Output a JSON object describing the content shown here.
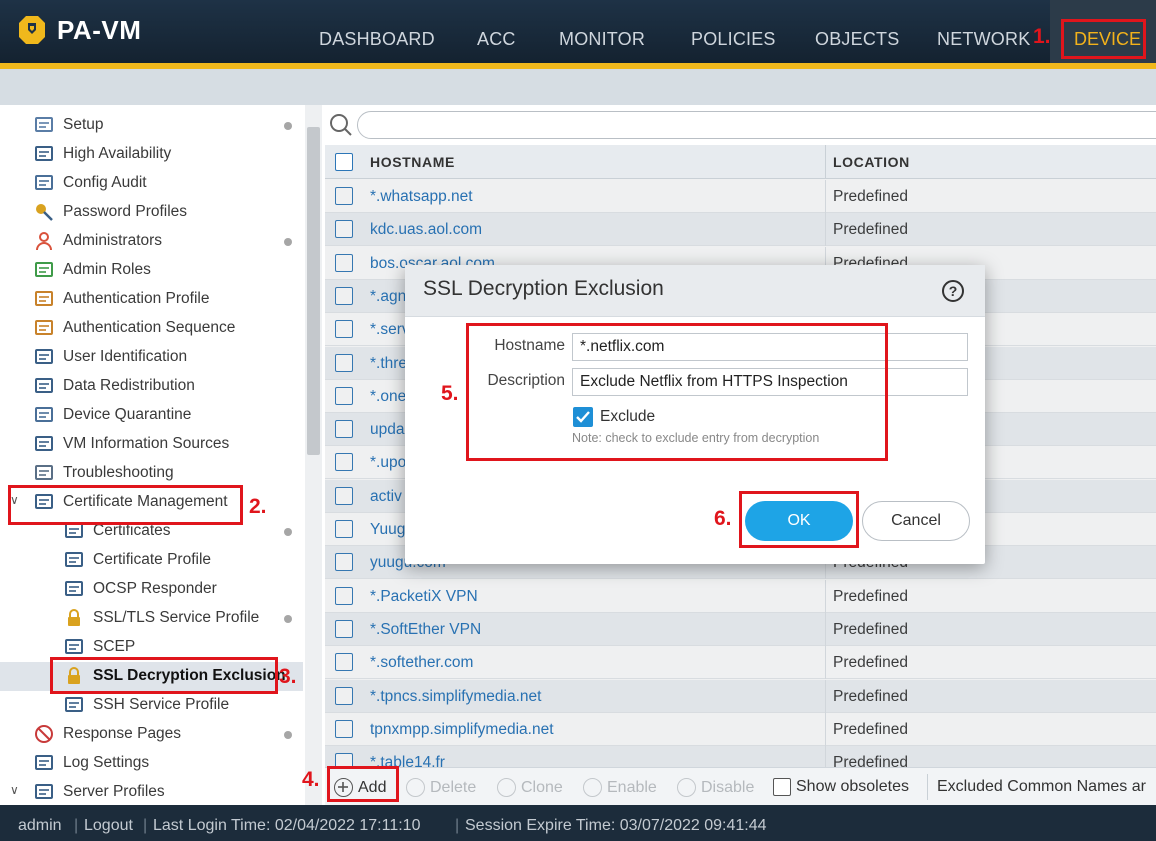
{
  "app": {
    "name": "PA-VM"
  },
  "nav": {
    "tabs": [
      "DASHBOARD",
      "ACC",
      "MONITOR",
      "POLICIES",
      "OBJECTS",
      "NETWORK",
      "DEVICE"
    ],
    "active": "DEVICE"
  },
  "sidebar": {
    "items": [
      {
        "label": "Setup",
        "icon": "setup-icon",
        "dot": true
      },
      {
        "label": "High Availability",
        "icon": "ha-icon",
        "dot": false
      },
      {
        "label": "Config Audit",
        "icon": "config-audit-icon",
        "dot": false
      },
      {
        "label": "Password Profiles",
        "icon": "key-icon",
        "dot": false
      },
      {
        "label": "Administrators",
        "icon": "user-icon",
        "dot": true
      },
      {
        "label": "Admin Roles",
        "icon": "admin-role-icon",
        "dot": false
      },
      {
        "label": "Authentication Profile",
        "icon": "auth-profile-icon",
        "dot": false
      },
      {
        "label": "Authentication Sequence",
        "icon": "auth-sequence-icon",
        "dot": false
      },
      {
        "label": "User Identification",
        "icon": "id-card-icon",
        "dot": false
      },
      {
        "label": "Data Redistribution",
        "icon": "network-tree-icon",
        "dot": false
      },
      {
        "label": "Device Quarantine",
        "icon": "monitor-icon",
        "dot": false
      },
      {
        "label": "VM Information Sources",
        "icon": "vm-icon",
        "dot": false
      },
      {
        "label": "Troubleshooting",
        "icon": "wrench-icon",
        "dot": false
      },
      {
        "label": "Certificate Management",
        "icon": "certificate-icon",
        "dot": false
      },
      {
        "label": "Certificates",
        "icon": "certificate-icon",
        "dot": true
      },
      {
        "label": "Certificate Profile",
        "icon": "certificate-icon",
        "dot": false
      },
      {
        "label": "OCSP Responder",
        "icon": "ocsp-icon",
        "dot": false
      },
      {
        "label": "SSL/TLS Service Profile",
        "icon": "lock-icon",
        "dot": true
      },
      {
        "label": "SCEP",
        "icon": "scep-icon",
        "dot": false
      },
      {
        "label": "SSL Decryption Exclusion",
        "icon": "lock-icon",
        "dot": false
      },
      {
        "label": "SSH Service Profile",
        "icon": "certificate-icon",
        "dot": false
      },
      {
        "label": "Response Pages",
        "icon": "no-entry-icon",
        "dot": true
      },
      {
        "label": "Log Settings",
        "icon": "log-icon",
        "dot": false
      },
      {
        "label": "Server Profiles",
        "icon": "server-icon",
        "dot": false
      }
    ]
  },
  "grid": {
    "columns": [
      "HOSTNAME",
      "LOCATION"
    ],
    "rows": [
      {
        "hostname": "*.whatsapp.net",
        "location": "Predefined"
      },
      {
        "hostname": "kdc.uas.aol.com",
        "location": "Predefined"
      },
      {
        "hostname": "bos.oscar.aol.com",
        "location": "Predefined"
      },
      {
        "hostname": "*.agn",
        "location": ""
      },
      {
        "hostname": "*.serv",
        "location": ""
      },
      {
        "hostname": "*.thre",
        "location": ""
      },
      {
        "hostname": "*.one",
        "location": ""
      },
      {
        "hostname": "upda",
        "location": ""
      },
      {
        "hostname": "*.upo",
        "location": ""
      },
      {
        "hostname": "activ",
        "location": ""
      },
      {
        "hostname": "Yuug",
        "location": ""
      },
      {
        "hostname": "yuugu.com",
        "location": "Predefined"
      },
      {
        "hostname": "*.PacketiX VPN",
        "location": "Predefined"
      },
      {
        "hostname": "*.SoftEther VPN",
        "location": "Predefined"
      },
      {
        "hostname": "*.softether.com",
        "location": "Predefined"
      },
      {
        "hostname": "*.tpncs.simplifymedia.net",
        "location": "Predefined"
      },
      {
        "hostname": "tpnxmpp.simplifymedia.net",
        "location": "Predefined"
      },
      {
        "hostname": "*.table14.fr",
        "location": "Predefined"
      }
    ]
  },
  "toolbar": {
    "add": "Add",
    "delete": "Delete",
    "clone": "Clone",
    "enable": "Enable",
    "disable": "Disable",
    "show_obsoletes": "Show obsoletes",
    "excluded_text": "Excluded Common Names ar"
  },
  "status": {
    "user": "admin",
    "logout": "Logout",
    "last_login": "Last Login Time: 02/04/2022 17:11:10",
    "session_expire": "Session Expire Time: 03/07/2022 09:41:44"
  },
  "dialog": {
    "title": "SSL Decryption Exclusion",
    "help": "?",
    "hostname_label": "Hostname",
    "hostname_value": "*.netflix.com",
    "description_label": "Description",
    "description_value": "Exclude Netflix from HTTPS Inspection",
    "exclude_label": "Exclude",
    "exclude_checked": true,
    "note": "Note: check to exclude entry from decryption",
    "ok": "OK",
    "cancel": "Cancel"
  },
  "annotations": {
    "step1": "1.",
    "step2": "2.",
    "step3": "3.",
    "step4": "4.",
    "step5": "5.",
    "step6": "6."
  },
  "colors": {
    "accent_yellow": "#f0b81c",
    "header_dark": "#1e3246",
    "link_blue": "#1d6fb8",
    "ok_blue": "#1ea4e6",
    "annotation_red": "#e0151c"
  }
}
